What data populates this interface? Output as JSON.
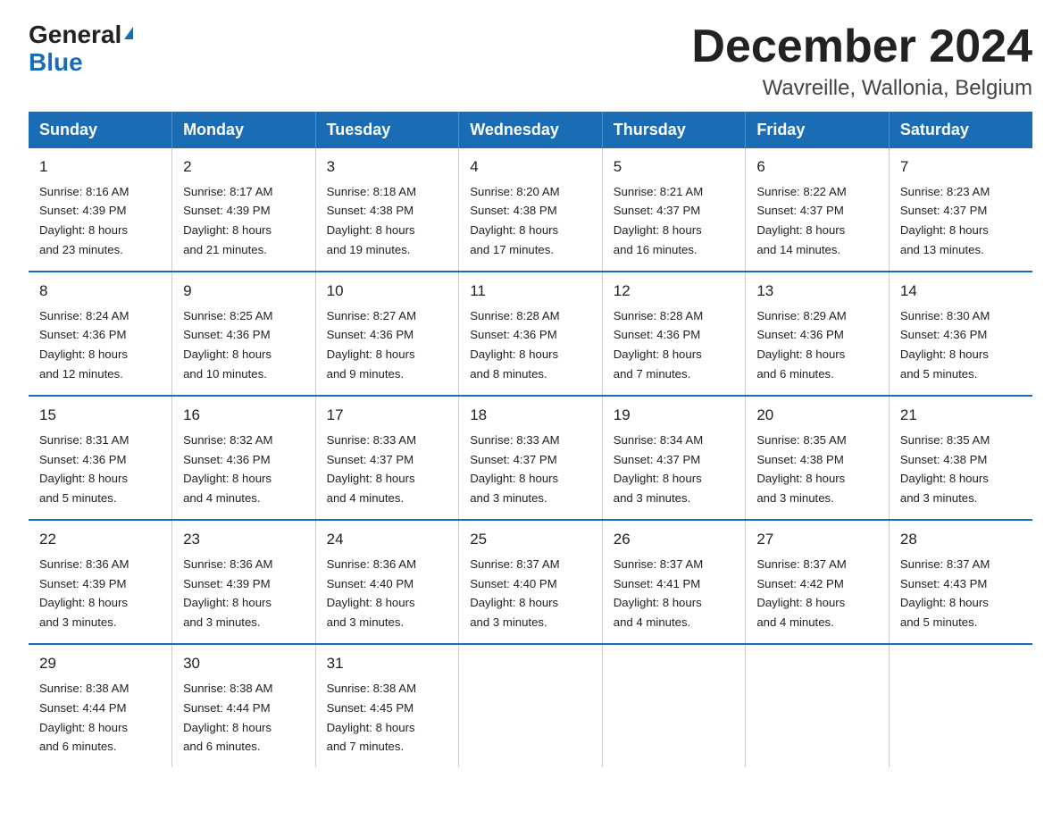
{
  "logo": {
    "general": "General",
    "blue": "Blue",
    "triangle": "▶"
  },
  "title": "December 2024",
  "subtitle": "Wavreille, Wallonia, Belgium",
  "days_of_week": [
    "Sunday",
    "Monday",
    "Tuesday",
    "Wednesday",
    "Thursday",
    "Friday",
    "Saturday"
  ],
  "weeks": [
    [
      {
        "day": "1",
        "sunrise": "8:16 AM",
        "sunset": "4:39 PM",
        "daylight": "8 hours and 23 minutes."
      },
      {
        "day": "2",
        "sunrise": "8:17 AM",
        "sunset": "4:39 PM",
        "daylight": "8 hours and 21 minutes."
      },
      {
        "day": "3",
        "sunrise": "8:18 AM",
        "sunset": "4:38 PM",
        "daylight": "8 hours and 19 minutes."
      },
      {
        "day": "4",
        "sunrise": "8:20 AM",
        "sunset": "4:38 PM",
        "daylight": "8 hours and 17 minutes."
      },
      {
        "day": "5",
        "sunrise": "8:21 AM",
        "sunset": "4:37 PM",
        "daylight": "8 hours and 16 minutes."
      },
      {
        "day": "6",
        "sunrise": "8:22 AM",
        "sunset": "4:37 PM",
        "daylight": "8 hours and 14 minutes."
      },
      {
        "day": "7",
        "sunrise": "8:23 AM",
        "sunset": "4:37 PM",
        "daylight": "8 hours and 13 minutes."
      }
    ],
    [
      {
        "day": "8",
        "sunrise": "8:24 AM",
        "sunset": "4:36 PM",
        "daylight": "8 hours and 12 minutes."
      },
      {
        "day": "9",
        "sunrise": "8:25 AM",
        "sunset": "4:36 PM",
        "daylight": "8 hours and 10 minutes."
      },
      {
        "day": "10",
        "sunrise": "8:27 AM",
        "sunset": "4:36 PM",
        "daylight": "8 hours and 9 minutes."
      },
      {
        "day": "11",
        "sunrise": "8:28 AM",
        "sunset": "4:36 PM",
        "daylight": "8 hours and 8 minutes."
      },
      {
        "day": "12",
        "sunrise": "8:28 AM",
        "sunset": "4:36 PM",
        "daylight": "8 hours and 7 minutes."
      },
      {
        "day": "13",
        "sunrise": "8:29 AM",
        "sunset": "4:36 PM",
        "daylight": "8 hours and 6 minutes."
      },
      {
        "day": "14",
        "sunrise": "8:30 AM",
        "sunset": "4:36 PM",
        "daylight": "8 hours and 5 minutes."
      }
    ],
    [
      {
        "day": "15",
        "sunrise": "8:31 AM",
        "sunset": "4:36 PM",
        "daylight": "8 hours and 5 minutes."
      },
      {
        "day": "16",
        "sunrise": "8:32 AM",
        "sunset": "4:36 PM",
        "daylight": "8 hours and 4 minutes."
      },
      {
        "day": "17",
        "sunrise": "8:33 AM",
        "sunset": "4:37 PM",
        "daylight": "8 hours and 4 minutes."
      },
      {
        "day": "18",
        "sunrise": "8:33 AM",
        "sunset": "4:37 PM",
        "daylight": "8 hours and 3 minutes."
      },
      {
        "day": "19",
        "sunrise": "8:34 AM",
        "sunset": "4:37 PM",
        "daylight": "8 hours and 3 minutes."
      },
      {
        "day": "20",
        "sunrise": "8:35 AM",
        "sunset": "4:38 PM",
        "daylight": "8 hours and 3 minutes."
      },
      {
        "day": "21",
        "sunrise": "8:35 AM",
        "sunset": "4:38 PM",
        "daylight": "8 hours and 3 minutes."
      }
    ],
    [
      {
        "day": "22",
        "sunrise": "8:36 AM",
        "sunset": "4:39 PM",
        "daylight": "8 hours and 3 minutes."
      },
      {
        "day": "23",
        "sunrise": "8:36 AM",
        "sunset": "4:39 PM",
        "daylight": "8 hours and 3 minutes."
      },
      {
        "day": "24",
        "sunrise": "8:36 AM",
        "sunset": "4:40 PM",
        "daylight": "8 hours and 3 minutes."
      },
      {
        "day": "25",
        "sunrise": "8:37 AM",
        "sunset": "4:40 PM",
        "daylight": "8 hours and 3 minutes."
      },
      {
        "day": "26",
        "sunrise": "8:37 AM",
        "sunset": "4:41 PM",
        "daylight": "8 hours and 4 minutes."
      },
      {
        "day": "27",
        "sunrise": "8:37 AM",
        "sunset": "4:42 PM",
        "daylight": "8 hours and 4 minutes."
      },
      {
        "day": "28",
        "sunrise": "8:37 AM",
        "sunset": "4:43 PM",
        "daylight": "8 hours and 5 minutes."
      }
    ],
    [
      {
        "day": "29",
        "sunrise": "8:38 AM",
        "sunset": "4:44 PM",
        "daylight": "8 hours and 6 minutes."
      },
      {
        "day": "30",
        "sunrise": "8:38 AM",
        "sunset": "4:44 PM",
        "daylight": "8 hours and 6 minutes."
      },
      {
        "day": "31",
        "sunrise": "8:38 AM",
        "sunset": "4:45 PM",
        "daylight": "8 hours and 7 minutes."
      },
      null,
      null,
      null,
      null
    ]
  ],
  "labels": {
    "sunrise": "Sunrise:",
    "sunset": "Sunset:",
    "daylight": "Daylight:"
  }
}
